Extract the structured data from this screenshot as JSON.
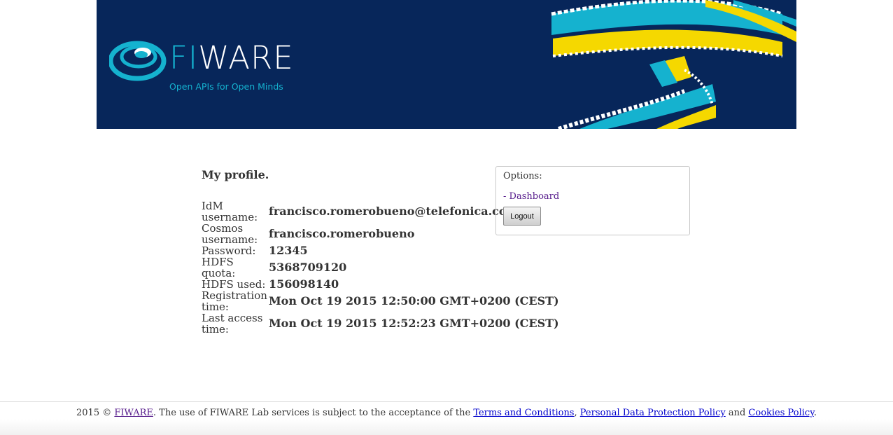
{
  "header": {
    "brand_prefix": "FI",
    "brand_suffix": "WARE",
    "tagline": "Open APIs for Open Minds"
  },
  "profile": {
    "title": "My profile.",
    "fields": [
      {
        "label": "IdM username:",
        "value": "francisco.romerobueno@telefonica.com"
      },
      {
        "label": "Cosmos username:",
        "value": "francisco.romerobueno"
      },
      {
        "label": "Password:",
        "value": "12345"
      },
      {
        "label": "HDFS quota:",
        "value": "5368709120"
      },
      {
        "label": "HDFS used:",
        "value": "156098140"
      },
      {
        "label": "Registration time:",
        "value": "Mon Oct 19 2015 12:50:00 GMT+0200 (CEST)"
      },
      {
        "label": "Last access time:",
        "value": "Mon Oct 19 2015 12:52:23 GMT+0200 (CEST)"
      }
    ]
  },
  "options": {
    "title": "Options:",
    "dashboard_link": "- Dashboard",
    "logout_label": "Logout"
  },
  "footer": {
    "prefix": "2015 © ",
    "fiware_link": "FIWARE",
    "middle": ". The use of FIWARE Lab services is subject to the acceptance of the ",
    "terms_link": "Terms and Conditions",
    "sep1": ", ",
    "privacy_link": "Personal Data Protection Policy",
    "sep2": " and ",
    "cookies_link": "Cookies Policy",
    "suffix": "."
  },
  "colors": {
    "banner_bg": "#07265a",
    "brand_cyan": "#15b2cf",
    "accent_yellow": "#f5d800"
  }
}
